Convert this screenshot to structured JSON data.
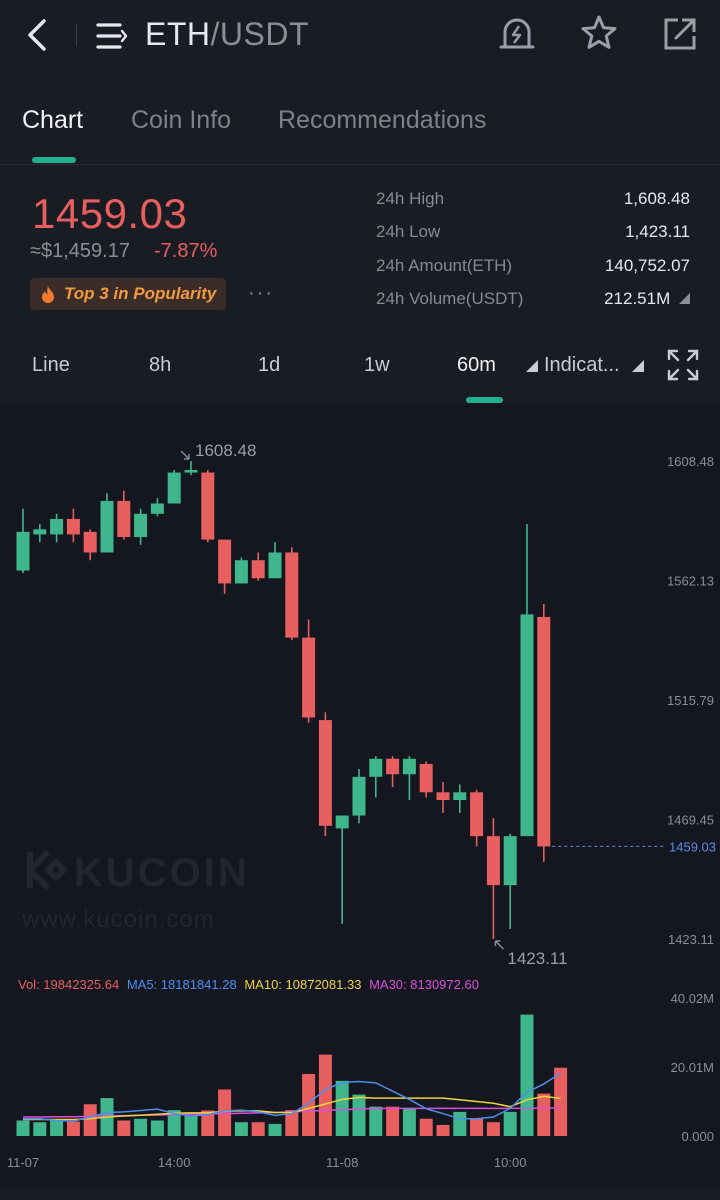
{
  "header": {
    "pair_base": "ETH",
    "pair_quote": "/USDT",
    "icons": [
      "back-icon",
      "menu-icon",
      "alert-bell-icon",
      "star-icon",
      "share-icon"
    ]
  },
  "tabs": [
    {
      "label": "Chart",
      "active": true
    },
    {
      "label": "Coin Info",
      "active": false
    },
    {
      "label": "Recommendations",
      "active": false
    }
  ],
  "ticker": {
    "last_price": "1459.03",
    "fiat_price": "≈$1,459.17",
    "change": "-7.87%",
    "badge": "Top 3 in Popularity",
    "more": "···",
    "stats": [
      {
        "label": "24h High",
        "value": "1,608.48"
      },
      {
        "label": "24h Low",
        "value": "1,423.11"
      },
      {
        "label": "24h Amount(ETH)",
        "value": "140,752.07"
      },
      {
        "label": "24h Volume(USDT)",
        "value": "212.51M"
      }
    ]
  },
  "intervals": {
    "items": [
      "Line",
      "8h",
      "1d",
      "1w",
      "60m"
    ],
    "active": "60m",
    "indicator_label": "Indicat..."
  },
  "colors": {
    "up": "#3fb68b",
    "down": "#e85f5f",
    "accent": "#24ae8f",
    "ma5": "#4a8ff0",
    "ma10": "#f0d43a",
    "ma30": "#d94fd9",
    "last_price_line": "#5b8de8"
  },
  "watermark": {
    "brand": "KUCOIN",
    "url": "www.kucoin.com"
  },
  "chart_data": {
    "type": "candlestick",
    "interval": "60m",
    "price_axis_ticks": [
      "1608.48",
      "1562.13",
      "1515.79",
      "1469.45",
      "1423.11"
    ],
    "price_axis_range": [
      1423.11,
      1608.48
    ],
    "last_price_label": "1459.03",
    "high_marker": "1608.48",
    "low_marker": "1423.11",
    "time_ticks": [
      {
        "label": "11-07",
        "index": 0
      },
      {
        "label": "14:00",
        "index": 9
      },
      {
        "label": "11-08",
        "index": 19
      },
      {
        "label": "10:00",
        "index": 29
      }
    ],
    "candles": [
      {
        "o": 1566,
        "h": 1590,
        "l": 1565,
        "c": 1581
      },
      {
        "o": 1580,
        "h": 1584,
        "l": 1577,
        "c": 1582
      },
      {
        "o": 1580,
        "h": 1588,
        "l": 1577,
        "c": 1586
      },
      {
        "o": 1586,
        "h": 1590,
        "l": 1577,
        "c": 1580
      },
      {
        "o": 1581,
        "h": 1582,
        "l": 1570,
        "c": 1573
      },
      {
        "o": 1573,
        "h": 1596,
        "l": 1573,
        "c": 1593
      },
      {
        "o": 1593,
        "h": 1597,
        "l": 1578,
        "c": 1579
      },
      {
        "o": 1579,
        "h": 1590,
        "l": 1576,
        "c": 1588
      },
      {
        "o": 1588,
        "h": 1594,
        "l": 1587,
        "c": 1592
      },
      {
        "o": 1592,
        "h": 1605,
        "l": 1592,
        "c": 1604
      },
      {
        "o": 1604,
        "h": 1608.48,
        "l": 1603,
        "c": 1605
      },
      {
        "o": 1604,
        "h": 1605,
        "l": 1577,
        "c": 1578
      },
      {
        "o": 1578,
        "h": 1578,
        "l": 1557,
        "c": 1561
      },
      {
        "o": 1561,
        "h": 1571,
        "l": 1561,
        "c": 1570
      },
      {
        "o": 1570,
        "h": 1573,
        "l": 1562,
        "c": 1563
      },
      {
        "o": 1563,
        "h": 1577,
        "l": 1563,
        "c": 1573
      },
      {
        "o": 1573,
        "h": 1575,
        "l": 1539,
        "c": 1540
      },
      {
        "o": 1540,
        "h": 1547,
        "l": 1507,
        "c": 1509
      },
      {
        "o": 1508,
        "h": 1511,
        "l": 1463,
        "c": 1467
      },
      {
        "o": 1466,
        "h": 1470,
        "l": 1429,
        "c": 1471
      },
      {
        "o": 1471,
        "h": 1489,
        "l": 1468,
        "c": 1486
      },
      {
        "o": 1486,
        "h": 1494,
        "l": 1478,
        "c": 1493
      },
      {
        "o": 1493,
        "h": 1494,
        "l": 1482,
        "c": 1487
      },
      {
        "o": 1487,
        "h": 1494,
        "l": 1477,
        "c": 1493
      },
      {
        "o": 1491,
        "h": 1492,
        "l": 1478,
        "c": 1480
      },
      {
        "o": 1480,
        "h": 1484,
        "l": 1472,
        "c": 1477
      },
      {
        "o": 1477,
        "h": 1483,
        "l": 1472,
        "c": 1480
      },
      {
        "o": 1480,
        "h": 1481,
        "l": 1459,
        "c": 1463
      },
      {
        "o": 1463,
        "h": 1470,
        "l": 1423.11,
        "c": 1444
      },
      {
        "o": 1444,
        "h": 1464,
        "l": 1427,
        "c": 1463
      },
      {
        "o": 1463,
        "h": 1584,
        "l": 1463,
        "c": 1549
      },
      {
        "o": 1548,
        "h": 1553,
        "l": 1453,
        "c": 1459
      }
    ],
    "volume_panel": {
      "axis_ticks": [
        "40.02M",
        "20.01M",
        "0.000"
      ],
      "axis_range": [
        0,
        40020000
      ],
      "legend": {
        "vol": "Vol: 19842325.64",
        "ma5": "MA5: 18181841.28",
        "ma10": "MA10: 10872081.33",
        "ma30": "MA30: 8130972.60"
      },
      "volumes": [
        4.5,
        4.0,
        4.5,
        4.2,
        9.2,
        11.0,
        4.5,
        5.0,
        4.5,
        7.5,
        6.0,
        7.4,
        13.5,
        4.0,
        4.0,
        3.5,
        7.5,
        18.0,
        23.6,
        16.0,
        12.0,
        8.5,
        8.5,
        8.0,
        5.0,
        3.2,
        7.0,
        5.0,
        4.0,
        7.0,
        35.2,
        12.3,
        19.8
      ],
      "ma5": [
        5.0,
        5.0,
        4.5,
        4.3,
        5.5,
        6.8,
        7.0,
        7.4,
        7.8,
        6.5,
        5.8,
        6.2,
        7.3,
        7.5,
        7.0,
        6.0,
        6.5,
        9.5,
        13.5,
        15.5,
        15.8,
        15.4,
        13.0,
        10.6,
        7.9,
        6.5,
        5.0,
        5.0,
        5.5,
        8.0,
        12.7,
        15.1,
        18.2
      ],
      "ma10": [
        4.8,
        4.8,
        4.8,
        4.8,
        5.0,
        5.5,
        5.8,
        6.0,
        6.3,
        6.6,
        6.7,
        6.7,
        7.2,
        7.3,
        7.3,
        6.8,
        6.8,
        8.0,
        9.3,
        10.6,
        11.2,
        11.0,
        11.0,
        11.0,
        11.0,
        11.0,
        10.5,
        10.0,
        9.5,
        8.5,
        10.5,
        11.5,
        10.9
      ],
      "ma30": [
        5.5,
        5.5,
        5.6,
        5.6,
        5.7,
        5.8,
        5.9,
        6.0,
        6.1,
        6.2,
        6.3,
        6.4,
        6.5,
        6.6,
        6.7,
        6.8,
        7.0,
        7.2,
        7.4,
        7.6,
        7.8,
        8.0,
        8.0,
        8.0,
        8.0,
        8.0,
        8.0,
        8.0,
        8.0,
        8.0,
        8.0,
        8.1,
        8.1
      ]
    }
  }
}
